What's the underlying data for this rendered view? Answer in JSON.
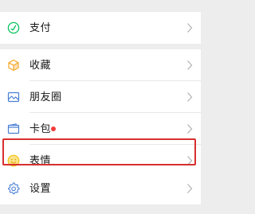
{
  "menu": {
    "pay": {
      "label": "支付",
      "icon": "pay-icon"
    },
    "favorites": {
      "label": "收藏",
      "icon": "cube-icon"
    },
    "moments": {
      "label": "朋友圈",
      "icon": "landscape-photo-icon"
    },
    "cards": {
      "label": "卡包",
      "icon": "wallet-icon",
      "has_badge": true
    },
    "stickers": {
      "label": "表情",
      "icon": "smiley-icon",
      "highlighted": true
    },
    "settings": {
      "label": "设置",
      "icon": "gear-icon"
    }
  },
  "colors": {
    "background": "#ededed",
    "surface": "#ffffff",
    "text": "#191919",
    "chevron": "#b2b2b2",
    "badge": "#f23c3c",
    "highlight_border": "#d6302e",
    "pay_icon": "#07c160",
    "favorites_icon": "#f5a623",
    "moments_icon": "#4a7fd4",
    "cards_icon": "#4a7fd4",
    "stickers_icon": "#f5c518",
    "settings_icon": "#4a7fd4"
  }
}
